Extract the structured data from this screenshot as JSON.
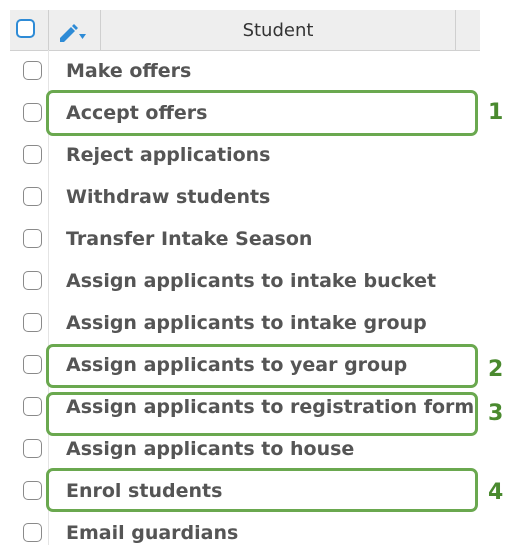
{
  "header": {
    "column_title": "Student"
  },
  "menu": {
    "items": [
      "Make offers",
      "Accept offers",
      "Reject applications",
      "Withdraw students",
      "Transfer Intake Season",
      "Assign applicants to intake bucket",
      "Assign applicants to intake group",
      "Assign applicants to year group",
      "Assign applicants to registration form",
      "Assign applicants to house",
      "Enrol students",
      "Email guardians"
    ]
  },
  "callouts": [
    "1",
    "2",
    "3",
    "4"
  ],
  "colors": {
    "accent_blue": "#2e8bd6",
    "highlight_green": "#6aa84f",
    "callout_text": "#4a8a2f"
  }
}
